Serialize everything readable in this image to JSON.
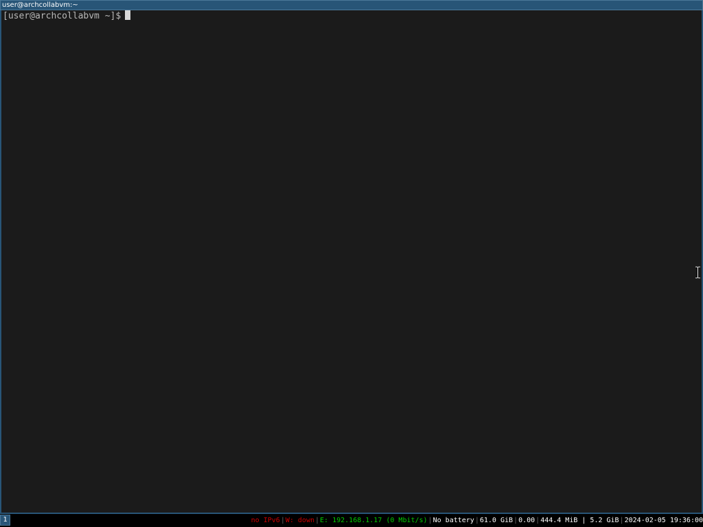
{
  "window": {
    "title": "user@archcollabvm:~"
  },
  "terminal": {
    "prompt": "[user@archcollabvm ~]$"
  },
  "bar": {
    "workspace": "1",
    "status": {
      "ipv6": "no IPv6",
      "wireless": "W: down",
      "ethernet": "E: 192.168.1.17 (0 Mbit/s)",
      "battery": "No battery",
      "disk": "61.0 GiB",
      "load": "0.00",
      "memory": "444.4 MiB | 5.2 GiB",
      "datetime": "2024-02-05 19:36:00"
    },
    "colors": {
      "bad": "#cc0000",
      "good": "#00cc00",
      "normal": "#ffffff"
    }
  },
  "icons": {
    "cursor": "text-cursor-ibeam-icon"
  }
}
